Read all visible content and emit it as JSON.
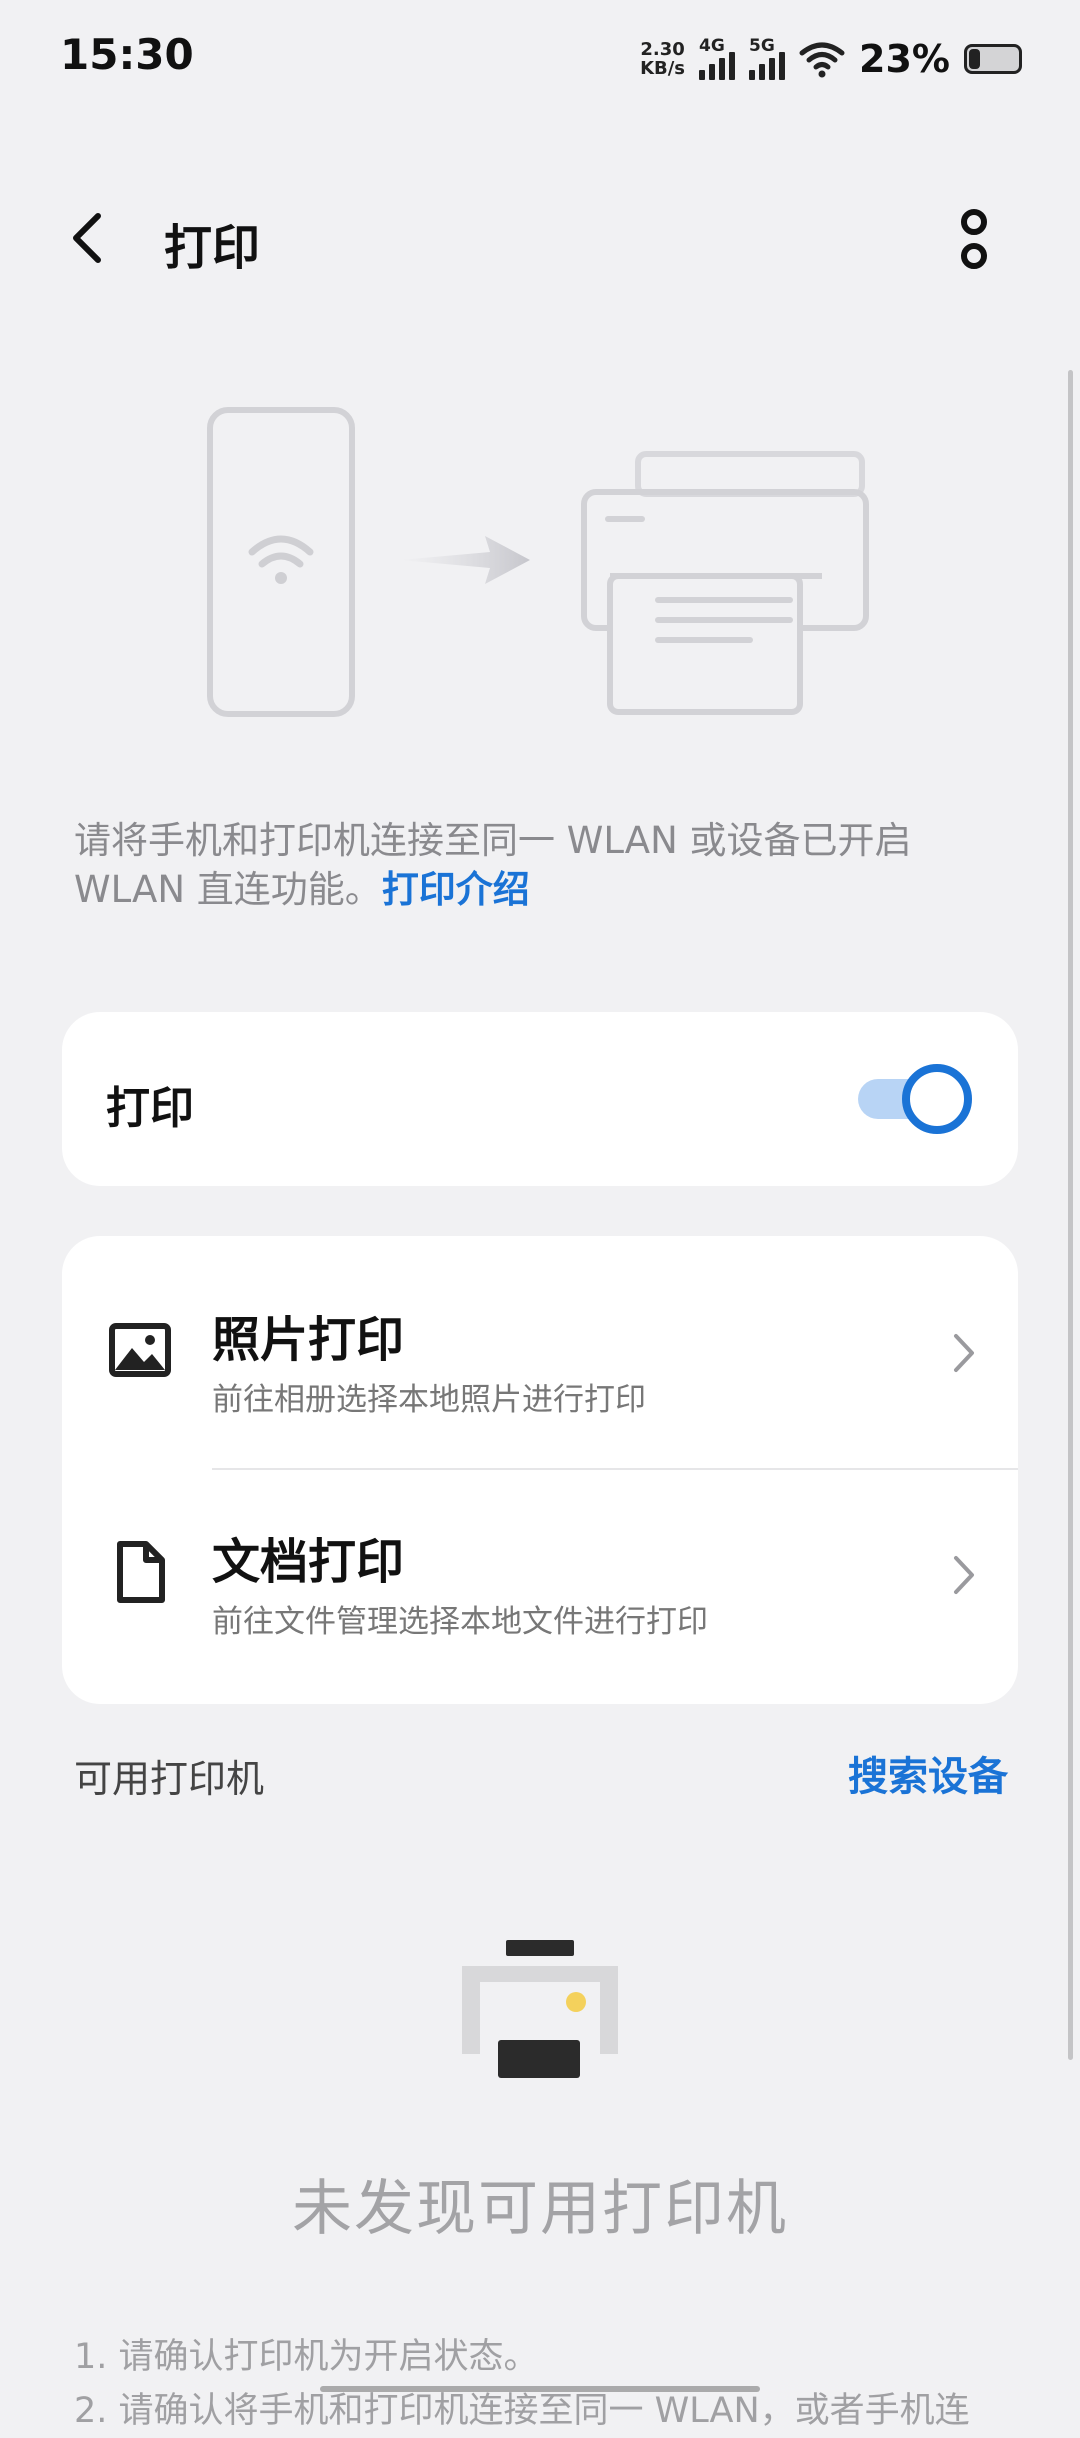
{
  "status_bar": {
    "time": "15:30",
    "net_speed_value": "2.30",
    "net_speed_unit": "KB/s",
    "signal1_label": "4G",
    "signal2_label": "5G",
    "battery_pct": "23%"
  },
  "header": {
    "title": "打印"
  },
  "hint": {
    "text": "请将手机和打印机连接至同一 WLAN 或设备已开启 WLAN 直连功能。",
    "link": "打印介绍"
  },
  "print_toggle": {
    "label": "打印",
    "on": true
  },
  "options": [
    {
      "title": "照片打印",
      "subtitle": "前往相册选择本地照片进行打印",
      "icon": "image-icon"
    },
    {
      "title": "文档打印",
      "subtitle": "前往文件管理选择本地文件进行打印",
      "icon": "document-icon"
    }
  ],
  "printers": {
    "label": "可用打印机",
    "search": "搜索设备",
    "empty_text": "未发现可用打印机",
    "notes": [
      "1. 请确认打印机为开启状态。",
      "2. 请确认将手机和打印机连接至同一 WLAN，或者手机连"
    ]
  },
  "colors": {
    "accent": "#1a73d6",
    "background": "#f1f1f3"
  }
}
